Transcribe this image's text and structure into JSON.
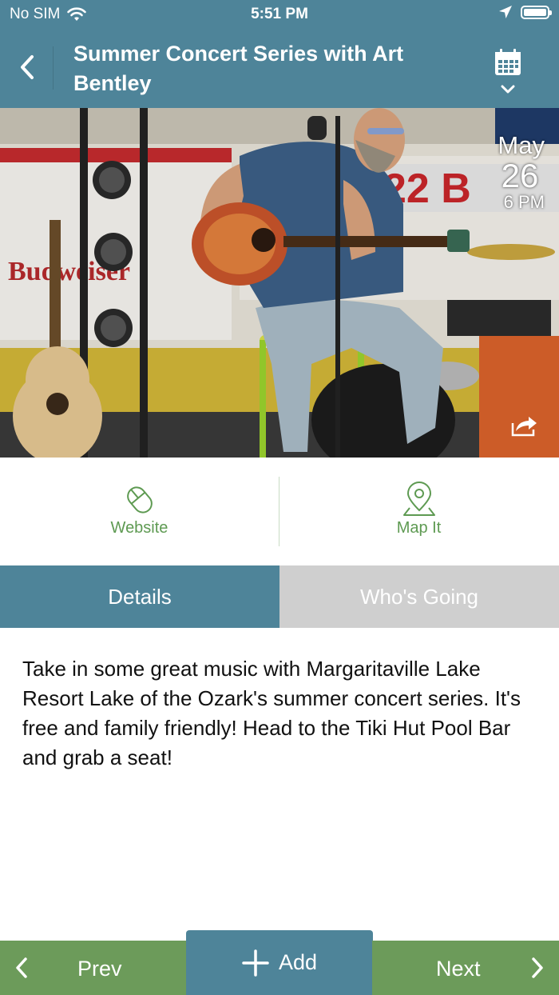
{
  "status_bar": {
    "carrier": "No SIM",
    "time": "5:51 PM"
  },
  "header": {
    "title": "Summer Concert Series with Art Bentley"
  },
  "event": {
    "month": "May",
    "day": "26",
    "time": "6 PM"
  },
  "actions": {
    "website_label": "Website",
    "map_label": "Map It"
  },
  "tabs": [
    {
      "label": "Details",
      "active": true
    },
    {
      "label": "Who's Going",
      "active": false
    }
  ],
  "description": "Take in some great music with Margaritaville Lake Resort Lake of the Ozark's summer concert series. It's free and family friendly! Head to the Tiki Hut Pool Bar and grab a seat!",
  "bottom_nav": {
    "prev_label": "Prev",
    "add_label": "Add",
    "next_label": "Next"
  },
  "colors": {
    "teal": "#4e8499",
    "green": "#6c9b5a",
    "link_green": "#5e9a52",
    "inactive_tab": "#cfcfcf"
  }
}
